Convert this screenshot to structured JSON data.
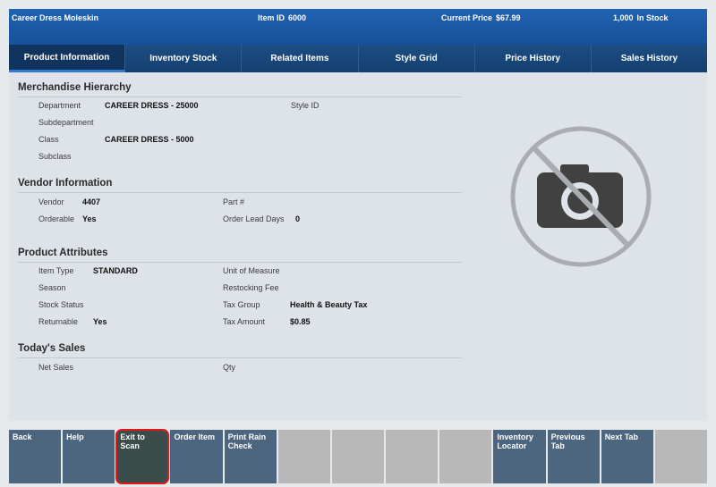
{
  "header": {
    "product_name": "Career Dress Moleskin",
    "item_id_label": "Item ID",
    "item_id": "6000",
    "price_label": "Current Price",
    "price": "$67.99",
    "stock_qty": "1,000",
    "stock_label": "In Stock"
  },
  "tabs": [
    {
      "label": "Product Information"
    },
    {
      "label": "Inventory Stock"
    },
    {
      "label": "Related Items"
    },
    {
      "label": "Style Grid"
    },
    {
      "label": "Price History"
    },
    {
      "label": "Sales History"
    }
  ],
  "merchandise": {
    "title": "Merchandise Hierarchy",
    "department_label": "Department",
    "department_value": "CAREER DRESS - 25000",
    "style_id_label": "Style ID",
    "subdepartment_label": "Subdepartment",
    "class_label": "Class",
    "class_value": "CAREER DRESS - 5000",
    "subclass_label": "Subclass"
  },
  "vendor": {
    "title": "Vendor Information",
    "vendor_label": "Vendor",
    "vendor_value": "4407",
    "part_label": "Part #",
    "orderable_label": "Orderable",
    "orderable_value": "Yes",
    "lead_days_label": "Order Lead Days",
    "lead_days_value": "0"
  },
  "attributes": {
    "title": "Product Attributes",
    "item_type_label": "Item Type",
    "item_type_value": "STANDARD",
    "uom_label": "Unit of Measure",
    "season_label": "Season",
    "restocking_label": "Restocking Fee",
    "stock_status_label": "Stock Status",
    "tax_group_label": "Tax Group",
    "tax_group_value": "Health & Beauty Tax",
    "returnable_label": "Returnable",
    "returnable_value": "Yes",
    "tax_amount_label": "Tax Amount",
    "tax_amount_value": "$0.85"
  },
  "sales": {
    "title": "Today's Sales",
    "net_sales_label": "Net Sales",
    "qty_label": "Qty"
  },
  "image_icon": "no-image-camera-icon",
  "footer": [
    {
      "label": "Back"
    },
    {
      "label": "Help"
    },
    {
      "label": "Exit to Scan"
    },
    {
      "label": "Order Item"
    },
    {
      "label": "Print Rain Check"
    },
    {
      "label": ""
    },
    {
      "label": ""
    },
    {
      "label": ""
    },
    {
      "label": ""
    },
    {
      "label": "Inventory Locator"
    },
    {
      "label": "Previous Tab"
    },
    {
      "label": "Next Tab"
    },
    {
      "label": ""
    }
  ],
  "colors": {
    "header_blue": "#1b5aa6",
    "tab_bar": "#123d6e",
    "button_slate": "#4d6680",
    "highlight": "#e01818"
  }
}
